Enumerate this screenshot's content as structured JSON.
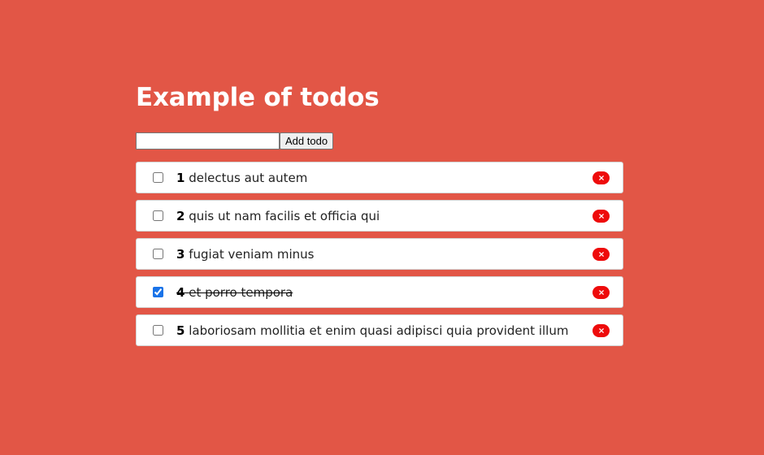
{
  "page": {
    "title": "Example of todos"
  },
  "form": {
    "input_value": "",
    "add_label": "Add todo"
  },
  "colors": {
    "background": "#e25646",
    "delete": "#ee0b0b",
    "checkbox": "#1a73e8"
  },
  "todos": [
    {
      "id": "1",
      "title": "delectus aut autem",
      "completed": false,
      "delete_icon": "close-icon"
    },
    {
      "id": "2",
      "title": "quis ut nam facilis et officia qui",
      "completed": false,
      "delete_icon": "close-icon"
    },
    {
      "id": "3",
      "title": "fugiat veniam minus",
      "completed": false,
      "delete_icon": "close-icon"
    },
    {
      "id": "4",
      "title": "et porro tempora",
      "completed": true,
      "delete_icon": "close-icon"
    },
    {
      "id": "5",
      "title": "laboriosam mollitia et enim quasi adipisci quia provident illum",
      "completed": false,
      "delete_icon": "close-icon"
    }
  ]
}
